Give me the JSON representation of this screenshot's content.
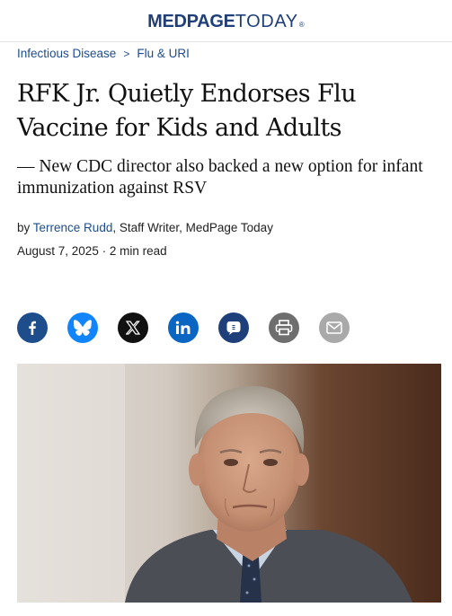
{
  "header": {
    "logo_med": "MEDPAGE",
    "logo_today": "TODAY",
    "logo_reg": "®"
  },
  "breadcrumb": {
    "items": [
      "Infectious Disease",
      "Flu & URI"
    ],
    "separator": ">"
  },
  "article": {
    "headline": "RFK Jr. Quietly Endorses Flu Vaccine for Kids and Adults",
    "subhead": "— New CDC director also backed a new option for infant immunization against RSV",
    "byline_prefix": "by",
    "author": "Terrence Rudd",
    "author_suffix": ", Staff Writer, MedPage Today",
    "date": "August 7, 2025",
    "date_sep": "·",
    "read_time": "2 min read"
  },
  "share": {
    "icons": [
      "facebook-icon",
      "bluesky-icon",
      "x-icon",
      "linkedin-icon",
      "substack-icon",
      "print-icon",
      "email-icon"
    ],
    "colors": {
      "facebook": "#1e4d8c",
      "bluesky": "#1185fe",
      "x": "#111111",
      "linkedin": "#0a66c2",
      "substack": "#1e3f7a",
      "print": "#6e6e6e",
      "email": "#a9a9a9"
    }
  },
  "brand": {
    "accent": "#1e3f7a",
    "link": "#1e4d8c"
  }
}
